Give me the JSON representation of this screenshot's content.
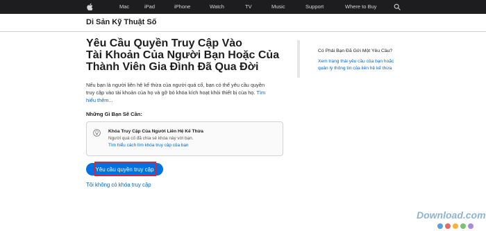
{
  "globalnav": {
    "items": [
      "Mac",
      "iPad",
      "iPhone",
      "Watch",
      "TV",
      "Music",
      "Support",
      "Where to Buy"
    ]
  },
  "subnav": {
    "title": "Di Sản Kỹ Thuật Số"
  },
  "main": {
    "title_lines": [
      "Yêu Cầu Quyền Truy Cập Vào",
      "Tài Khoản Của Người Bạn Hoặc Của",
      "Thành Viên Gia Đình Đã Qua Đời"
    ],
    "intro_lines": [
      "Nếu bạn là người liên hệ kế thừa của người quá cố, bạn có thể yêu cầu quyền",
      "truy cập vào tài khoản của họ và gỡ bỏ khóa kích hoạt khỏi thiết bị của họ."
    ],
    "intro_link_part1": "Tìm",
    "intro_link_part2": "hiểu thêm...",
    "needs_heading": "Những Gì Bạn Sẽ Cần:",
    "info_box": {
      "icon": "lightbulb-icon",
      "title": "Khóa Truy Cập Của Người Liên Hệ Kế Thừa",
      "description": "Người quá cố đã chia sẻ khóa này với bạn.",
      "link": "Tìm hiểu cách tìm khóa truy cập của bạn"
    },
    "cta_label": "Yêu cầu quyền truy cập",
    "alt_link": "Tôi không có khóa truy cập"
  },
  "aside": {
    "heading": "Có Phải Bạn Đã Gửi Một Yêu Cầu?",
    "link_lines": [
      "Xem trạng thái yêu cầu của bạn hoặc",
      "quản lý thông tin của liên hệ kế thừa"
    ]
  },
  "watermark": {
    "text": "Download.com.vn",
    "dot_colors": [
      "#5aa0d8",
      "#e46a6a",
      "#f2b440",
      "#7cc36e",
      "#a98bd6"
    ]
  },
  "colors": {
    "nav_bg": "#1d1d1f",
    "accent": "#0071e3",
    "link": "#0066cc",
    "highlight": "#e0242f"
  }
}
